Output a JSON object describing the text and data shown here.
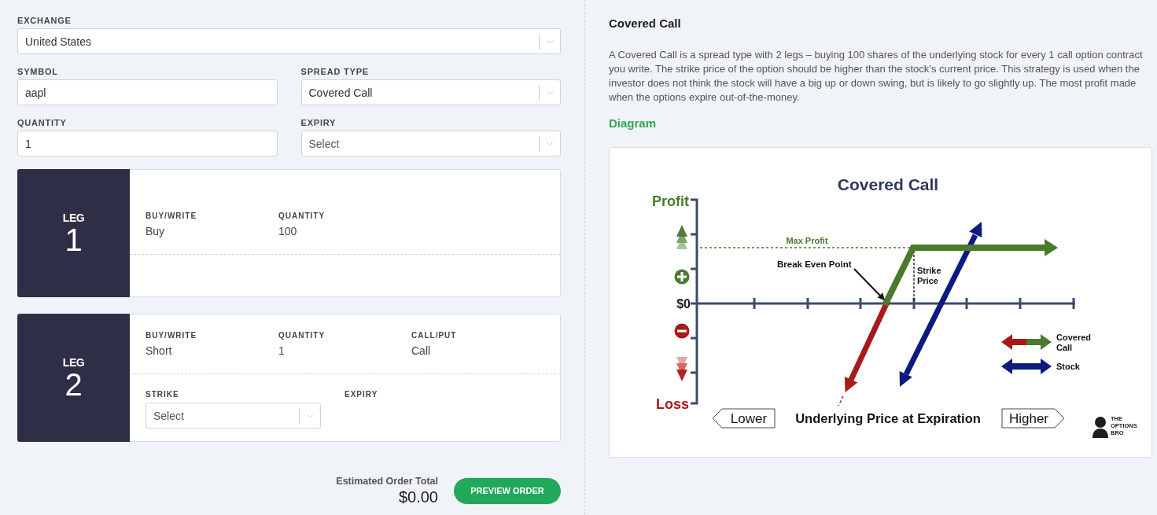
{
  "form_rows": [
    [
      {
        "kind": "select",
        "label": "EXCHANGE",
        "value": "United States"
      }
    ],
    [
      {
        "kind": "text",
        "label": "SYMBOL",
        "value": "aapl"
      },
      {
        "kind": "select",
        "label": "SPREAD TYPE",
        "value": "Covered Call"
      }
    ],
    [
      {
        "kind": "text",
        "label": "QUANTITY",
        "value": "1"
      },
      {
        "kind": "select",
        "label": "EXPIRY",
        "placeholder": "Select"
      }
    ]
  ],
  "legs": [
    {
      "heading": "LEG",
      "number": "1",
      "fields": [
        {
          "label": "BUY/WRITE",
          "value": "Buy"
        },
        {
          "label": "QUANTITY",
          "value": "100"
        }
      ]
    },
    {
      "heading": "LEG",
      "number": "2",
      "fields": [
        {
          "label": "BUY/WRITE",
          "value": "Short"
        },
        {
          "label": "QUANTITY",
          "value": "1"
        },
        {
          "label": "CALL/PUT",
          "value": "Call"
        }
      ],
      "lower_fields": [
        {
          "kind": "select",
          "label": "STRIKE",
          "placeholder": "Select"
        },
        {
          "kind": "label",
          "label": "EXPIRY"
        }
      ]
    }
  ],
  "order_total": {
    "label": "Estimated Order Total",
    "value": "$0.00"
  },
  "preview_button": "PREVIEW ORDER",
  "info": {
    "title": "Covered Call",
    "description": "A Covered Call is a spread type with 2 legs – buying 100 shares of the underlying stock for every 1 call option contract you write. The strike price of the option should be higher than the stock’s current price. This strategy is used when the investor does not think the stock will have a big up or down swing, but is likely to go slightly up. The most profit made when the options expire out-of-the-money.",
    "diagram_heading": "Diagram",
    "diagram": {
      "title": "Covered Call",
      "y_labels": {
        "top": "Profit",
        "zero": "$0",
        "bottom": "Loss"
      },
      "max_profit": "Max Profit",
      "break_even": "Break Even Point",
      "strike_lines": [
        "Strike",
        "Price"
      ],
      "legend": [
        {
          "kind": "covered_call",
          "lines": [
            "Covered",
            "Call"
          ]
        },
        {
          "kind": "stock",
          "lines": [
            "Stock"
          ]
        }
      ],
      "x_axis": {
        "lower": "Lower",
        "label": "Underlying Price at Expiration",
        "higher": "Higher"
      },
      "logo_lines": [
        "THE",
        "OPTIONS",
        "BRO"
      ]
    }
  }
}
